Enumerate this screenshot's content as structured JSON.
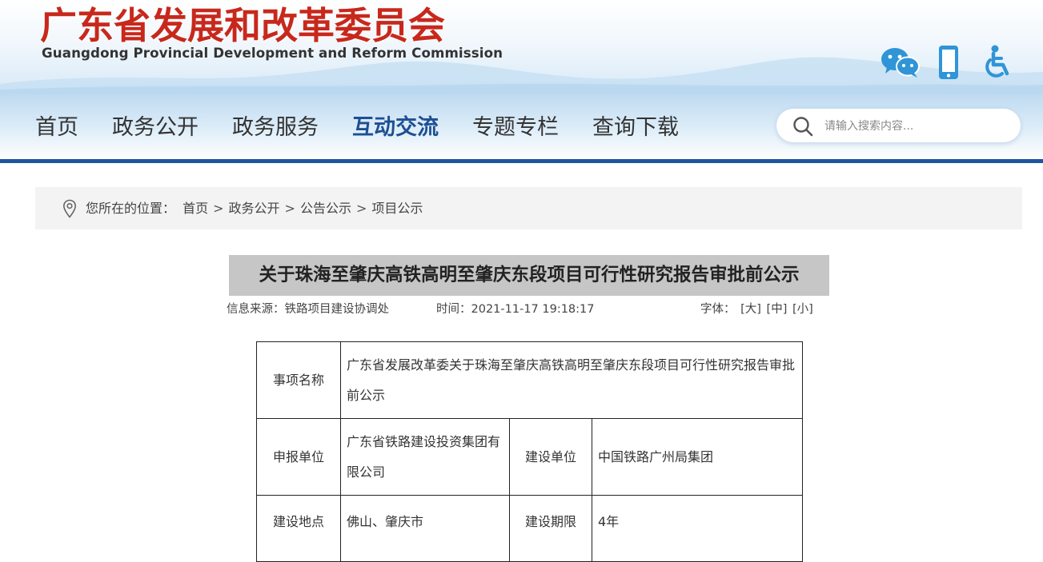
{
  "header": {
    "title": "广东省发展和改革委员会",
    "subtitle": "Guangdong Provincial Development and Reform Commission",
    "brand_color": "#c8281c",
    "tools": [
      {
        "name": "wechat-icon"
      },
      {
        "name": "mobile-icon"
      },
      {
        "name": "accessibility-icon"
      }
    ]
  },
  "nav": {
    "items": [
      {
        "label": "首页",
        "active": false
      },
      {
        "label": "政务公开",
        "active": false
      },
      {
        "label": "政务服务",
        "active": false
      },
      {
        "label": "互动交流",
        "active": true
      },
      {
        "label": "专题专栏",
        "active": false
      },
      {
        "label": "查询下载",
        "active": false
      }
    ],
    "accent_color": "#1d55a0",
    "search": {
      "placeholder": "请输入搜索内容...",
      "value": ""
    }
  },
  "breadcrumb": {
    "prefix": "您所在的位置：",
    "items": [
      "首页",
      "政务公开",
      "公告公示",
      "项目公示"
    ],
    "separator": ">"
  },
  "article": {
    "title": "关于珠海至肇庆高铁高明至肇庆东段项目可行性研究报告审批前公示",
    "source": "信息来源：铁路项目建设协调处",
    "time": "时间：2021-11-17 19:18:17",
    "font_label": "字体：",
    "font_sizes": [
      "[大]",
      "[中]",
      "[小]"
    ]
  },
  "table": {
    "item_name_label": "事项名称",
    "item_name_value": "广东省发展改革委关于珠海至肇庆高铁高明至肇庆东段项目可行性研究报告审批前公示",
    "applicant_label": "申报单位",
    "applicant_value": "广东省铁路建设投资集团有限公司",
    "builder_label": "建设单位",
    "builder_value": "中国铁路广州局集团",
    "location_label": "建设地点",
    "location_value": "佛山、肇庆市",
    "period_label": "建设期限",
    "period_value": "4年"
  }
}
